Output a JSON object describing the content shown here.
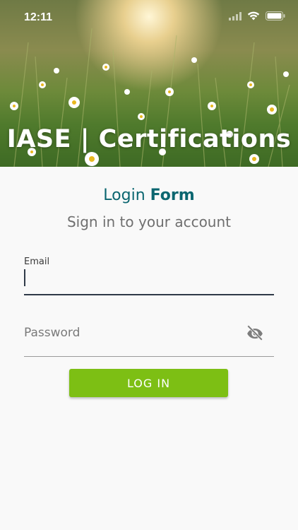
{
  "status_bar": {
    "time": "12:11",
    "icons": [
      "signal-icon",
      "wifi-icon",
      "battery-icon"
    ]
  },
  "hero": {
    "title": "IASE | Certifications"
  },
  "form": {
    "title_prefix": "Login",
    "title_bold": "Form",
    "subtitle": "Sign in to your account",
    "email": {
      "label": "Email",
      "value": ""
    },
    "password": {
      "placeholder": "Password",
      "value": "",
      "toggle_icon": "eye-off-icon"
    },
    "login_label": "LOG IN"
  },
  "colors": {
    "accent_teal": "#0b6670",
    "button_green": "#7dbf14",
    "background": "#f9f9f9"
  }
}
